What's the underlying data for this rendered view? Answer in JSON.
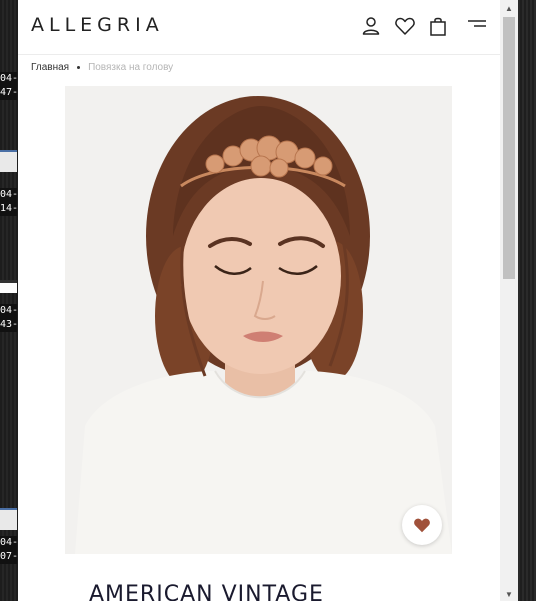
{
  "desktop": {
    "stamps": [
      "04-",
      "47-",
      "04-",
      "14-",
      "04-",
      "43-",
      "04-",
      "07-"
    ]
  },
  "header": {
    "logo": "ALLEGRIA",
    "icons": [
      "user-icon",
      "heart-icon",
      "bag-icon",
      "menu-icon"
    ]
  },
  "breadcrumb": {
    "home": "Главная",
    "current": "Повязка на голову"
  },
  "product": {
    "image": "model-with-gold-headband",
    "favorite_icon": "heart-icon",
    "title": "AMERICAN VINTAGE"
  },
  "colors": {
    "accent": "#a0513a",
    "text": "#222222",
    "muted": "#b5b5b5"
  }
}
